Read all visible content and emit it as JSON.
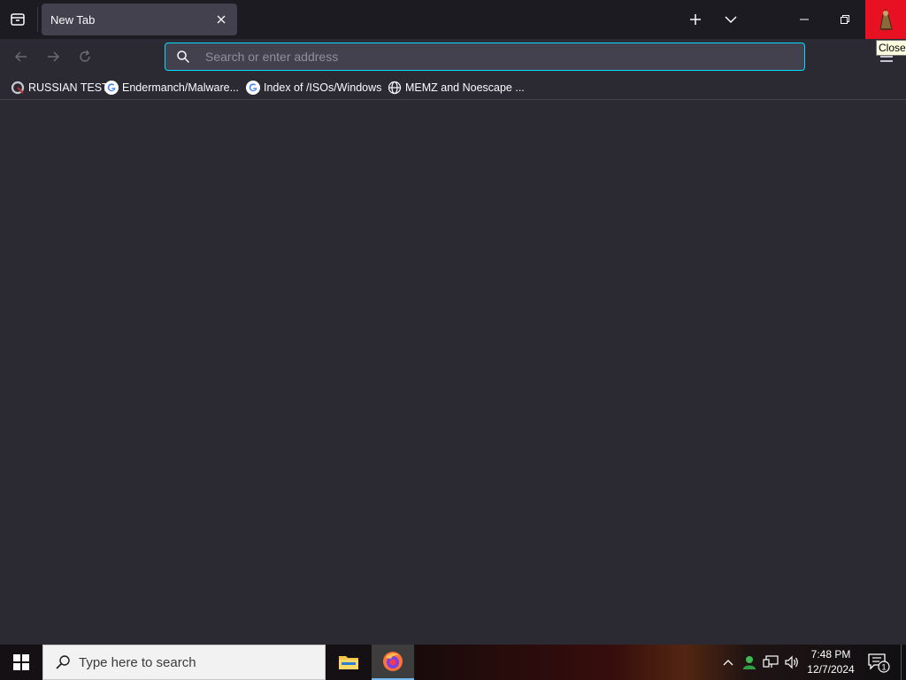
{
  "browser": {
    "tabs": [
      {
        "title": "New Tab"
      }
    ],
    "tooltip": "Close",
    "urlbar": {
      "placeholder": "Search or enter address",
      "value": ""
    },
    "bookmarks": [
      {
        "label": "RUSSIAN TEST",
        "icon": "custom-site-icon"
      },
      {
        "label": "Endermanch/Malware...",
        "icon": "google-icon"
      },
      {
        "label": "Index of /ISOs/Windows",
        "icon": "google-icon"
      },
      {
        "label": "MEMZ and Noescape ...",
        "icon": "globe-icon"
      }
    ],
    "colors": {
      "accent": "#00ddff",
      "close_hover": "#e81123",
      "toolbar": "#2b2a33",
      "tabstrip": "#1c1b22"
    }
  },
  "taskbar": {
    "search_placeholder": "Type here to search",
    "clock": {
      "time": "7:48 PM",
      "date": "12/7/2024"
    },
    "notification_count": "1",
    "apps": [
      "File Explorer",
      "Firefox"
    ]
  }
}
